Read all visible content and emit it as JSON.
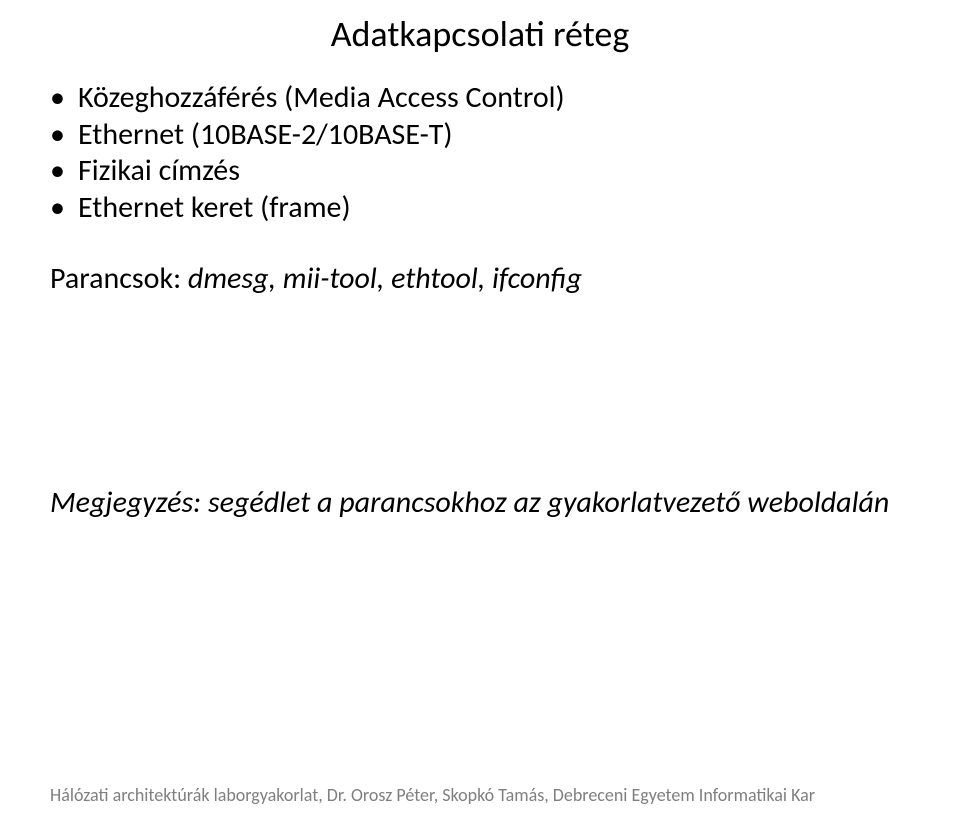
{
  "title": "Adatkapcsolati réteg",
  "bullets": [
    "Közeghozzáférés (Media Access Control)",
    "Ethernet (10BASE-2/10BASE-T)",
    "Fizikai címzés",
    "Ethernet keret (frame)"
  ],
  "commands": {
    "label": "Parancsok:",
    "list": "dmesg, mii-tool, ethtool, ifconfig"
  },
  "note": "Megjegyzés: segédlet a parancsokhoz az gyakorlatvezető weboldalán",
  "footer": "Hálózati architektúrák laborgyakorlat, Dr. Orosz Péter, Skopkó Tamás, Debreceni Egyetem Informatikai Kar"
}
